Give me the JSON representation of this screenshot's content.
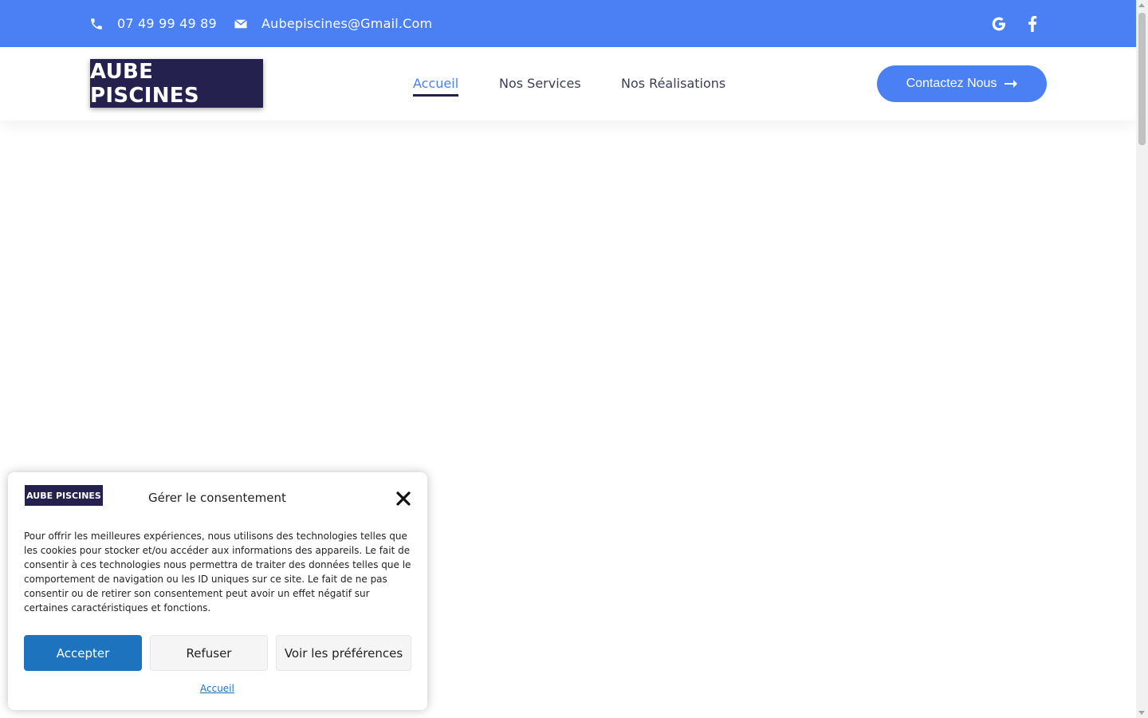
{
  "topbar": {
    "phone": "07 49 99 49 89",
    "email": "Aubepiscines@Gmail.Com",
    "icons": [
      "phone-icon",
      "envelope-icon",
      "google-icon",
      "facebook-icon"
    ]
  },
  "header": {
    "logo_text": "AUBE PISCINES",
    "nav": [
      {
        "label": "Accueil",
        "active": true
      },
      {
        "label": "Nos Services",
        "active": false
      },
      {
        "label": "Nos Réalisations",
        "active": false
      }
    ],
    "cta_label": "Contactez Nous"
  },
  "consent": {
    "logo_text": "AUBE PISCINES",
    "title": "Gérer le consentement",
    "body": "Pour offrir les meilleures expériences, nous utilisons des technologies telles que les cookies pour stocker et/ou accéder aux informations des appareils. Le fait de consentir à ces technologies nous permettra de traiter des données telles que le comportement de navigation ou les ID uniques sur ce site. Le fait de ne pas consentir ou de retirer son consentement peut avoir un effet négatif sur certaines caractéristiques et fonctions.",
    "accept_label": "Accepter",
    "refuse_label": "Refuser",
    "prefs_label": "Voir les préférences",
    "footer_link": "Accueil"
  },
  "colors": {
    "primary": "#4b80f5",
    "navy": "#24214f",
    "accept": "#1e73be"
  }
}
